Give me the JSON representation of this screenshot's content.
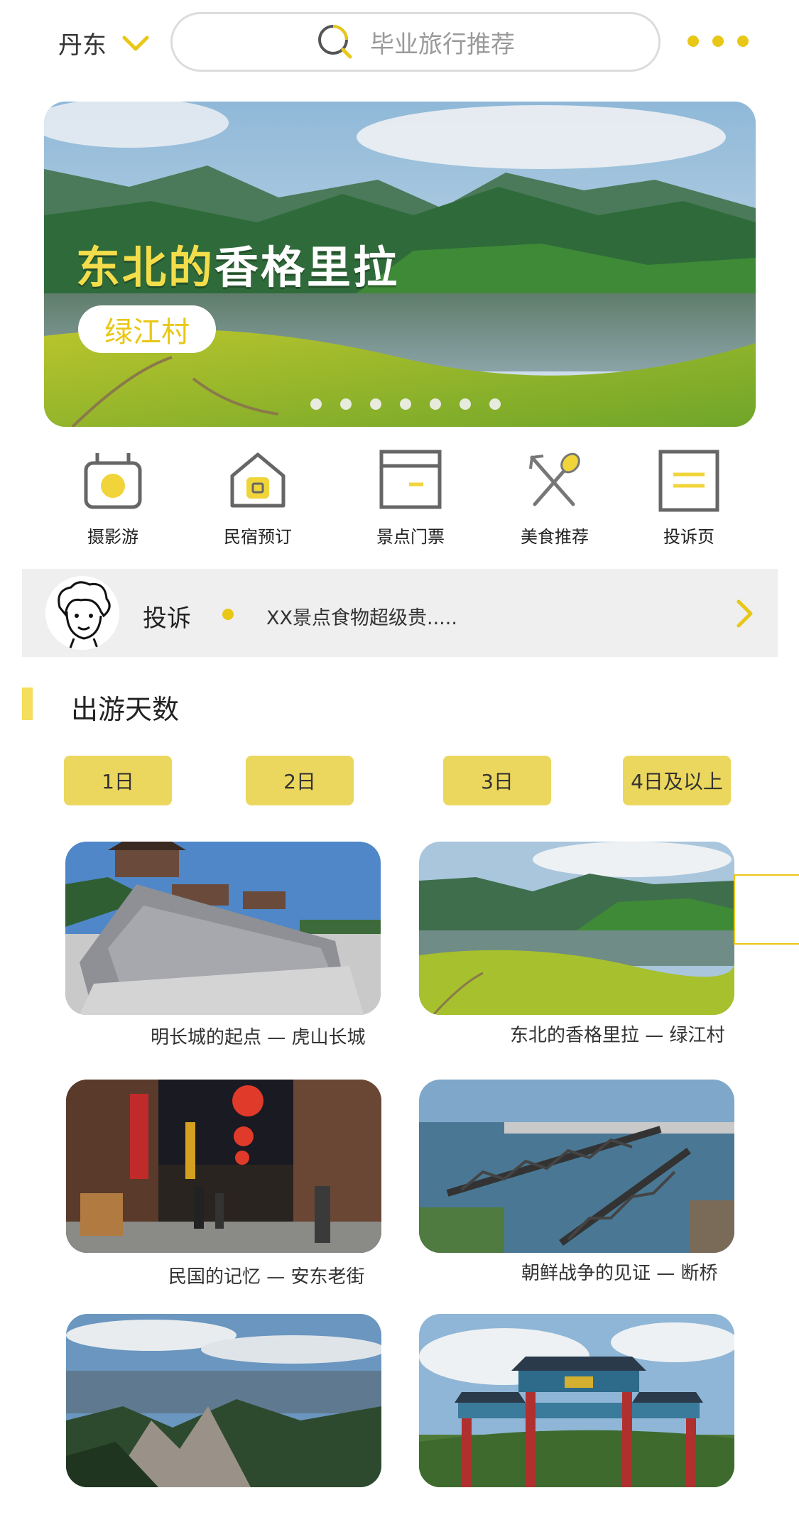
{
  "header": {
    "city": "丹东",
    "search_placeholder": "毕业旅行推荐"
  },
  "banner": {
    "title_part1": "东北的",
    "title_part2": "香格里拉",
    "tag": "绿江村",
    "dot_count": 7
  },
  "categories": [
    {
      "label": "摄影游",
      "icon": "camera-icon"
    },
    {
      "label": "民宿预订",
      "icon": "house-icon"
    },
    {
      "label": "景点门票",
      "icon": "ticket-icon"
    },
    {
      "label": "美食推荐",
      "icon": "utensils-icon"
    },
    {
      "label": "投诉页",
      "icon": "document-icon"
    }
  ],
  "complaint": {
    "title": "投诉",
    "text": "XX景点食物超级贵....."
  },
  "section": {
    "title": "出游天数"
  },
  "days": [
    "1日",
    "2日",
    "3日",
    "4日及以上"
  ],
  "cards": [
    {
      "caption": "明长城的起点 — 虎山长城"
    },
    {
      "caption": "东北的香格里拉 — 绿江村"
    },
    {
      "caption": "民国的记忆 — 安东老街"
    },
    {
      "caption": "朝鲜战争的见证 — 断桥"
    },
    {
      "caption": ""
    },
    {
      "caption": ""
    }
  ],
  "colors": {
    "accent": "#e9c716",
    "button": "#ecd75e",
    "bar_bg": "#efefef"
  }
}
